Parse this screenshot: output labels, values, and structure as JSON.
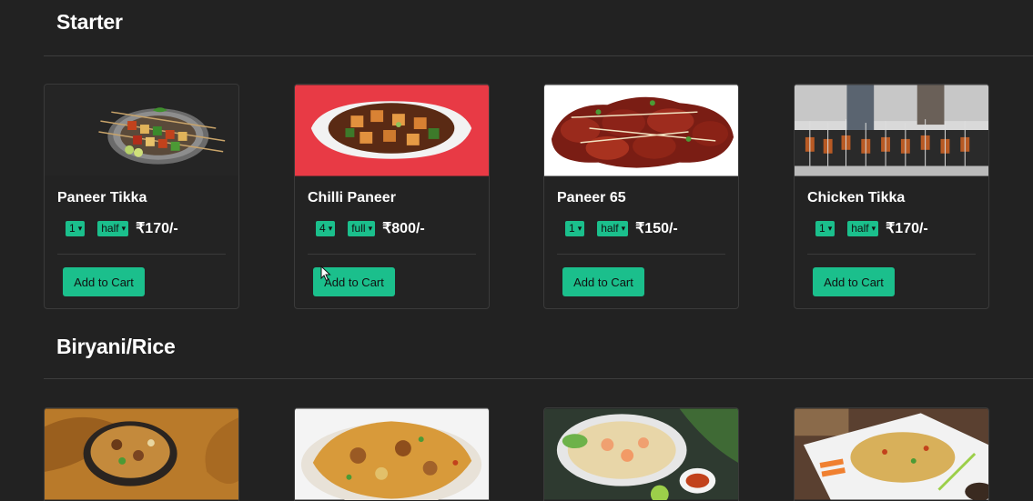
{
  "sections": [
    {
      "title": "Starter",
      "items": [
        {
          "name": "Paneer Tikka",
          "qty": "1",
          "size": "half",
          "price": "₹170/-",
          "button": "Add to Cart"
        },
        {
          "name": "Chilli Paneer",
          "qty": "4",
          "size": "full",
          "price": "₹800/-",
          "button": "Add to Cart"
        },
        {
          "name": "Paneer 65",
          "qty": "1",
          "size": "half",
          "price": "₹150/-",
          "button": "Add to Cart"
        },
        {
          "name": "Chicken Tikka",
          "qty": "1",
          "size": "half",
          "price": "₹170/-",
          "button": "Add to Cart"
        }
      ]
    },
    {
      "title": "Biryani/Rice"
    }
  ],
  "icons": {
    "select_arrow": "chevron-down-icon",
    "cursor": "mouse-pointer-icon"
  },
  "colors": {
    "background": "#222222",
    "accent": "#1bbf8c",
    "card_border": "#3a3a3a"
  }
}
